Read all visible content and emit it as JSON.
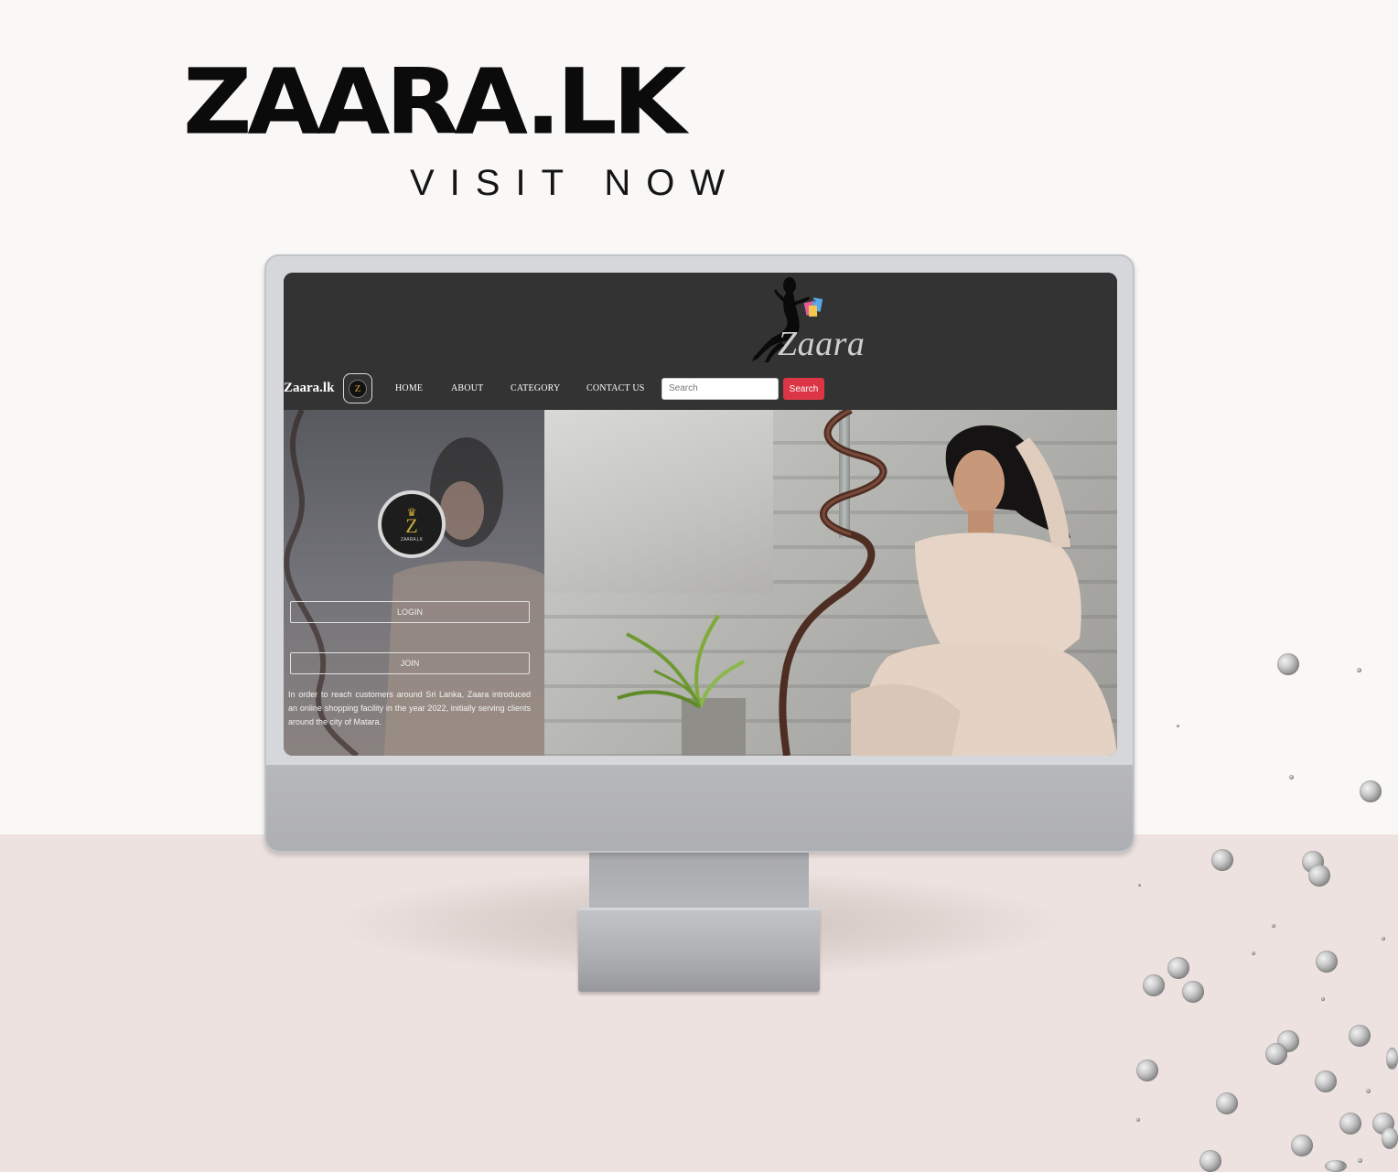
{
  "poster": {
    "headline": "ZAARA.LK",
    "subline": "VISIT NOW",
    "colors": {
      "upper_bg": "#f9f8f6",
      "lower_bg": "#ede2df"
    }
  },
  "site": {
    "header": {
      "logo_text": "Zaara",
      "brand": "Zaara.lk",
      "brand_icon_letter": "Z",
      "nav": [
        "HOME",
        "ABOUT",
        "CATEGORY",
        "CONTACT US"
      ],
      "search": {
        "placeholder": "Search",
        "button": "Search"
      },
      "colors": {
        "bar": "#333333",
        "search_button": "#dc3545"
      }
    },
    "panel": {
      "logo_letter": "Z",
      "logo_caption": "ZAARA.LK",
      "login": "LOGIN",
      "join": "JOIN",
      "description": "In order to reach customers around Sri Lanka, Zaara introduced an online shopping facility in the year 2022, initially serving clients around the city of Matara."
    }
  }
}
